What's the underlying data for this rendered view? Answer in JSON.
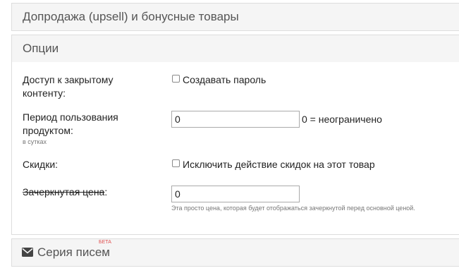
{
  "sections": {
    "upsell_title": "Допродажа (upsell) и бонусные товары",
    "options_title": "Опции",
    "letters_title": "Серия писем",
    "letters_badge": "БЕТА"
  },
  "fields": {
    "access": {
      "label": "Доступ к закрытому контенту:",
      "checkbox_label": "Создавать пароль",
      "checked": false
    },
    "period": {
      "label": "Период пользования продуктом:",
      "hint": "в сутках",
      "value": "0",
      "after": "0 = неограничено"
    },
    "discounts": {
      "label": "Скидки:",
      "checkbox_label": "Исключить действие скидок на этот товар",
      "checked": false
    },
    "strike_price": {
      "label_struck": "Зачеркнутая цена",
      "label_colon": ":",
      "value": "0",
      "help": "Эта просто цена, которая будет отображаться зачеркнутой перед основной ценой."
    }
  },
  "icons": {
    "letters": "envelope-icon"
  }
}
